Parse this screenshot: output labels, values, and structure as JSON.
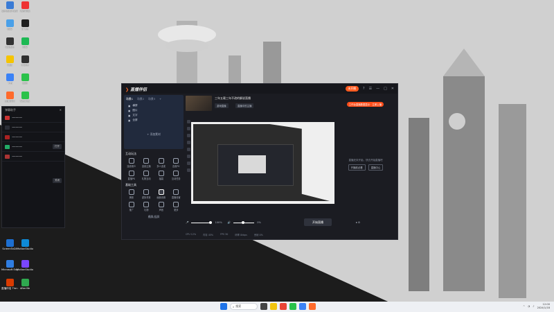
{
  "desktop": {
    "icons": [
      {
        "label": "微信视频号助手 · 直播",
        "color": "#3a7bd5"
      },
      {
        "label": "我的电脑",
        "color": "#4aa0e8"
      },
      {
        "label": "剪映",
        "color": "#1e1e1e"
      },
      {
        "label": "Q飞书",
        "color": "#2f7de1"
      },
      {
        "label": "QQ音乐",
        "color": "#1db954"
      },
      {
        "label": "剪映",
        "color": "#222"
      },
      {
        "label": "OBS",
        "color": "#303030"
      },
      {
        "label": "小红书",
        "color": "#e33"
      },
      {
        "label": "飞书",
        "color": "#3b82f6"
      },
      {
        "label": "直播伴侣",
        "color": "#ff6a2b"
      },
      {
        "label": "微信",
        "color": "#2ac24a"
      },
      {
        "label": "WeChat",
        "color": "#2ac24a"
      },
      {
        "label": "回收站",
        "color": "#b0b0b0"
      },
      {
        "label": "在线下载中心",
        "color": "#e35"
      },
      {
        "label": "飞书会议",
        "color": "#3b82f6"
      },
      {
        "label": "ScreenToGif",
        "color": "#1d6fd1"
      },
      {
        "label": "MotionStudio",
        "color": "#7a46ff"
      },
      {
        "label": "Microsoft Edge",
        "color": "#0e8ad6"
      },
      {
        "label": "直播伴侣 The recording",
        "color": "#d83b01"
      },
      {
        "label": "Afterlife",
        "color": "#2fa84f"
      }
    ]
  },
  "chat_panel": {
    "title": "弹幕助手",
    "close_label": "关闭",
    "open_label": "打开"
  },
  "app": {
    "logo_mark": "❯",
    "logo_text": "直播伴侣",
    "live_status": "未开播",
    "room_title": "三年五载三年不改的解说直播",
    "chip_1": "游戏直播",
    "chip_2": "直播中的主播",
    "notice": "工作台直播数据显示 · 立即上播",
    "window_controls": [
      "?",
      "☰",
      "—",
      "□",
      "✕"
    ],
    "scenes": {
      "tabs": [
        "场景1",
        "场景2",
        "场景3",
        "+"
      ],
      "sources": [
        "横屏",
        "图片",
        "文字",
        "全屏"
      ],
      "add_source": "+ 添加素材"
    },
    "interact_tools": {
      "title": "互动玩法",
      "items": [
        "连线观众",
        "连线主播",
        "多人连麦",
        "连麦PK",
        "直播PK",
        "礼物互动",
        "福袋",
        "互动任务"
      ]
    },
    "basic_tools": {
      "title": "基础工具",
      "items": [
        "美颜",
        "虚拟背景",
        "画面设置",
        "直播设置",
        "推广",
        "礼物",
        "声音",
        "更多"
      ]
    },
    "scene_ratio": "横屏/竖屏",
    "controls": {
      "mic_label": "100%",
      "speaker_label": "0%"
    },
    "start_live": "开始直播",
    "status_bar": [
      "CPU 12%",
      "内存 45%",
      "FPS 30",
      "码率 0kbps",
      "丢帧 0%"
    ],
    "right_panel": {
      "text": "直播还未开始，快去开始直播吧",
      "btn_1": "开播前必看",
      "btn_2": "直播中心"
    }
  },
  "taskbar": {
    "search_placeholder": "搜索",
    "time": "12:00",
    "date": "2024/1/18"
  }
}
